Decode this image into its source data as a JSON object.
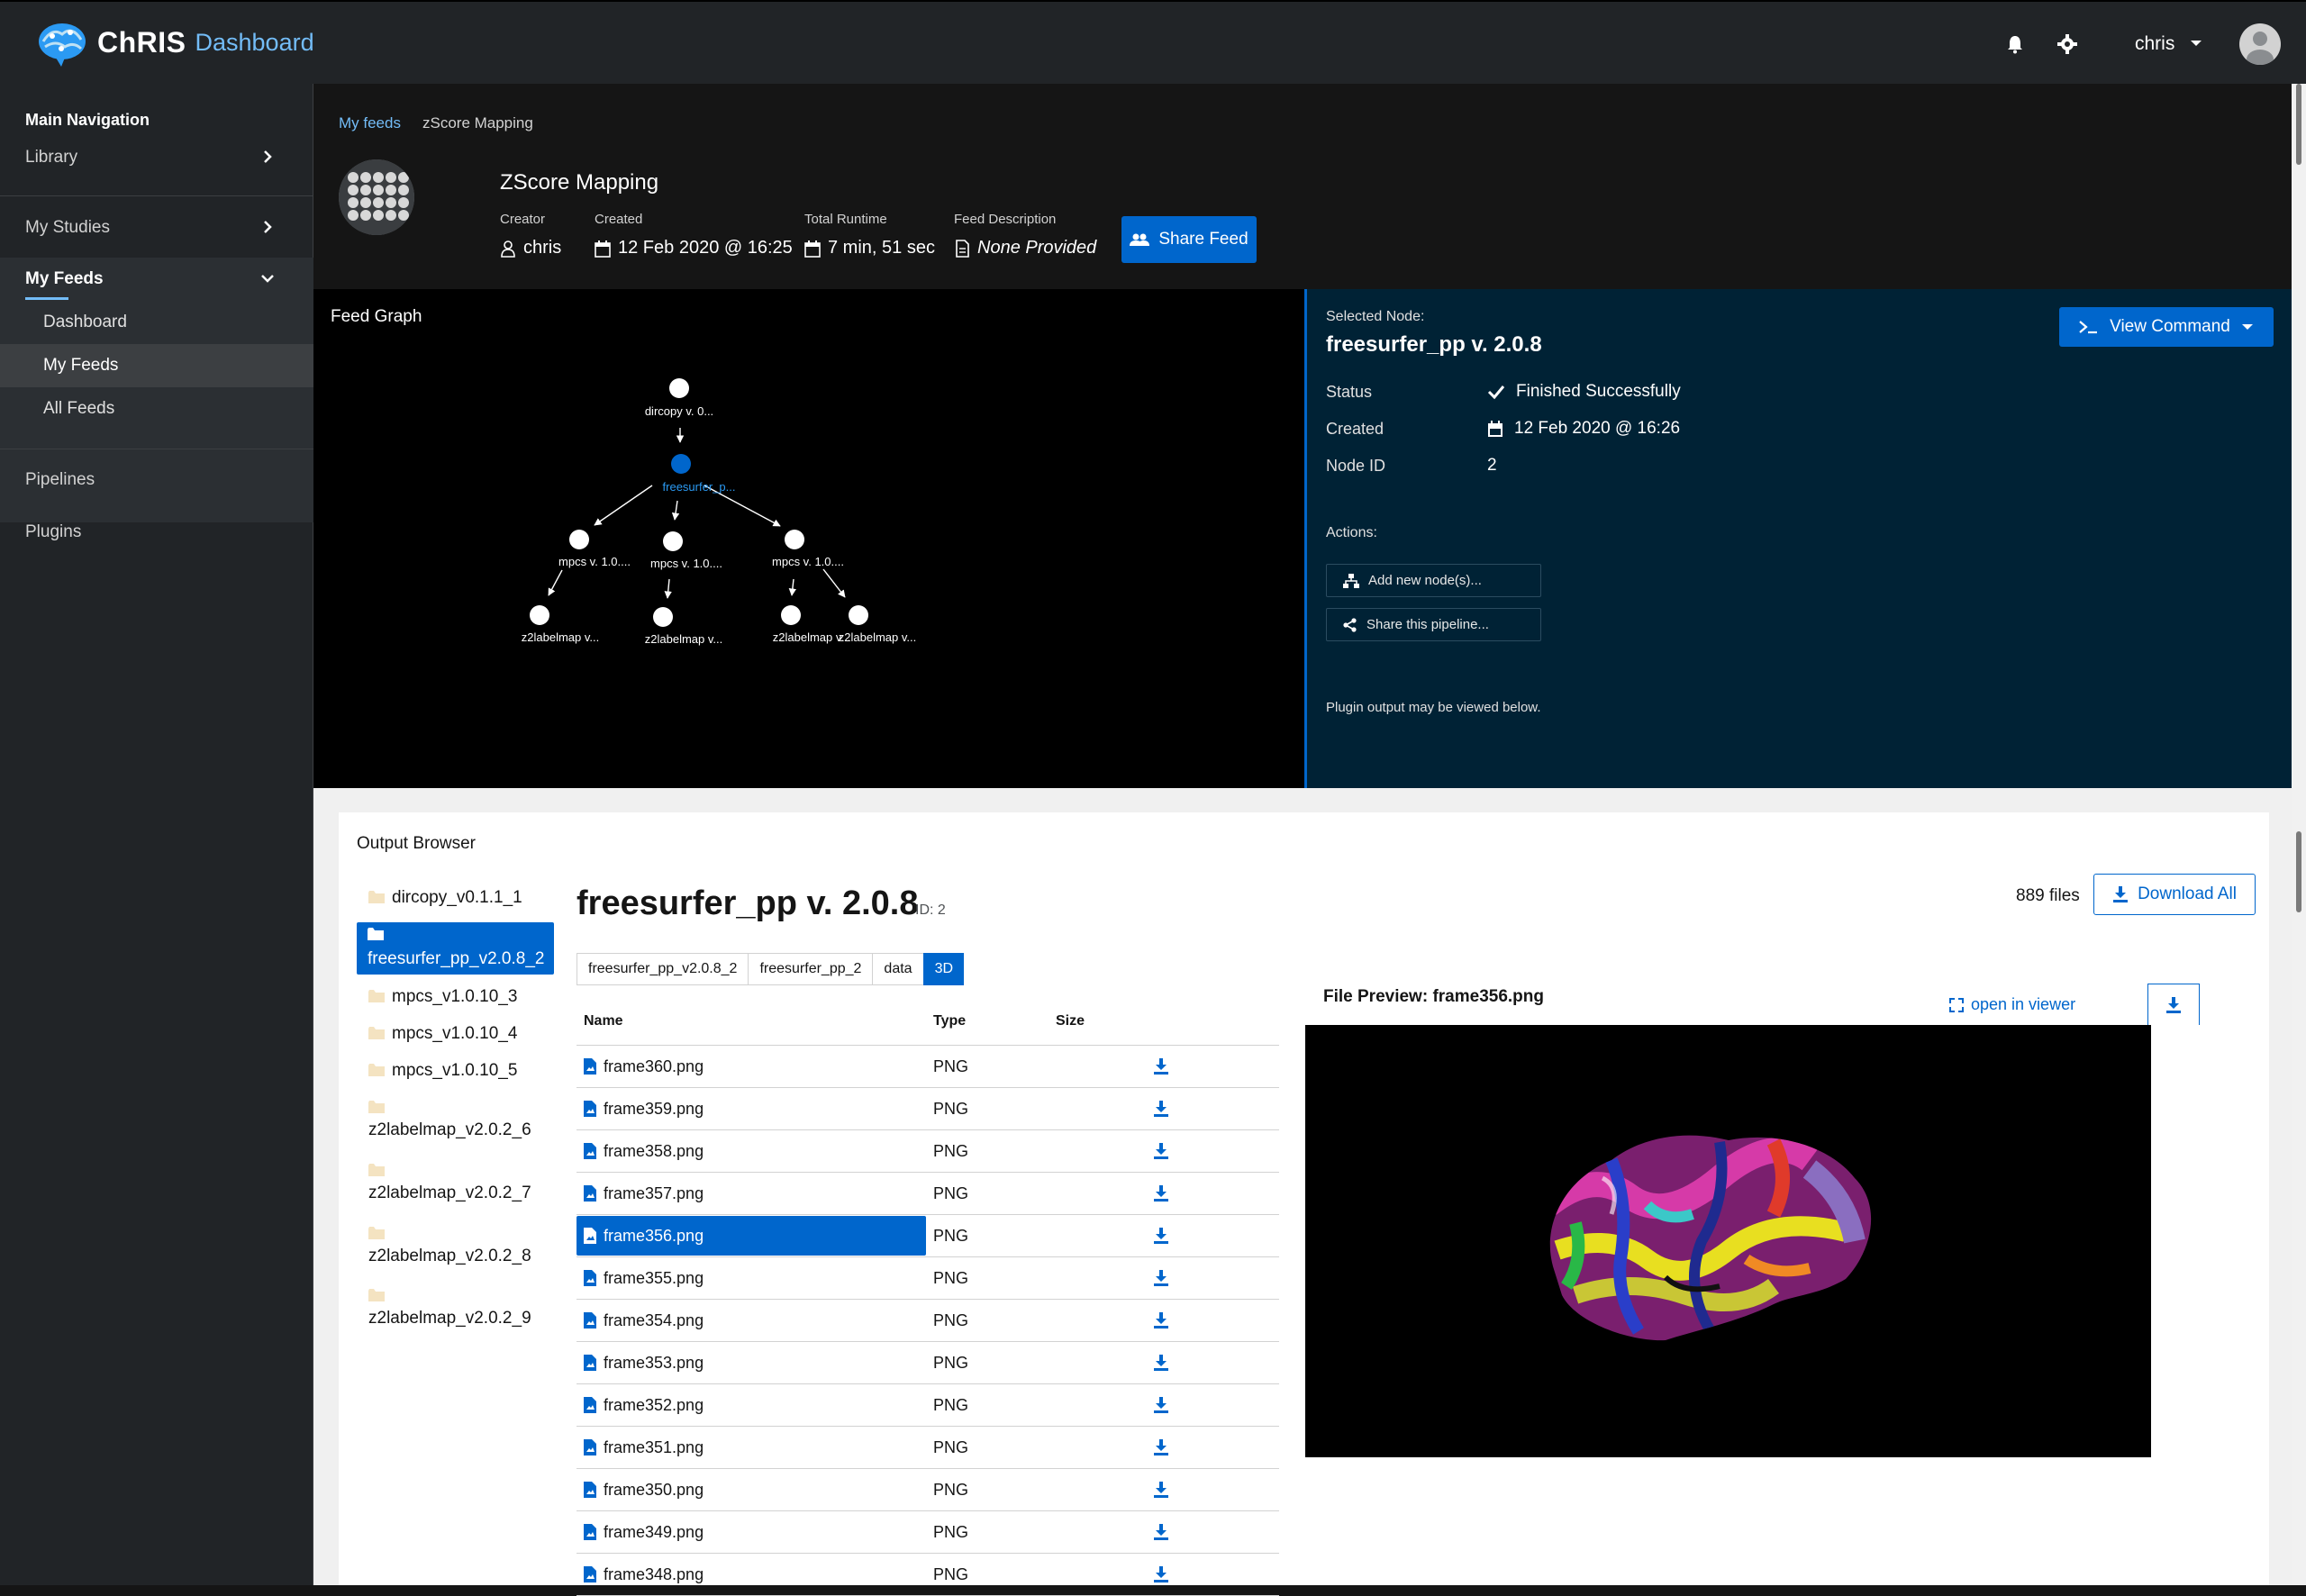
{
  "masthead": {
    "brand_name": "ChRIS",
    "brand_sub": "Dashboard",
    "user": "chris"
  },
  "sidebar": {
    "title": "Main Navigation",
    "items": [
      {
        "label": "Library"
      },
      {
        "label": "My Studies"
      },
      {
        "label": "My Feeds"
      },
      {
        "label": "Pipelines"
      },
      {
        "label": "Plugins"
      }
    ],
    "subitems": [
      {
        "label": "Dashboard"
      },
      {
        "label": "My Feeds"
      },
      {
        "label": "All Feeds"
      }
    ]
  },
  "feed": {
    "breadcrumb": [
      "My feeds",
      "zScore Mapping"
    ],
    "title": "ZScore Mapping",
    "creator_label": "Creator",
    "creator": "chris",
    "created_label": "Created",
    "created": "12 Feb 2020 @ 16:25",
    "runtime_label": "Total Runtime",
    "runtime": "7 min, 51 sec",
    "desc_label": "Feed Description",
    "desc": "None Provided",
    "share_label": "Share Feed"
  },
  "graph": {
    "title": "Feed Graph",
    "nodes": [
      {
        "label": "dircopy v. 0..."
      },
      {
        "label": "freesurfer_p..."
      },
      {
        "label": "mpcs v. 1.0...."
      },
      {
        "label": "mpcs v. 1.0...."
      },
      {
        "label": "mpcs v. 1.0...."
      },
      {
        "label": "z2labelmap v..."
      },
      {
        "label": "z2labelmap v..."
      },
      {
        "label": "z2labelmap v..."
      },
      {
        "label": "z2labelmap v..."
      }
    ]
  },
  "node": {
    "selected_label": "Selected Node:",
    "title": "freesurfer_pp v. 2.0.8",
    "view_command": "View Command",
    "status_key": "Status",
    "status": "Finished Successfully",
    "created_key": "Created",
    "created": "12 Feb 2020 @ 16:26",
    "id_key": "Node ID",
    "id": "2",
    "actions_label": "Actions:",
    "add_node": "Add new node(s)...",
    "share_pipeline": "Share this pipeline...",
    "output_note": "Plugin output may be viewed below."
  },
  "output": {
    "title": "Output Browser",
    "dirs": [
      "dircopy_v0.1.1_1",
      "freesurfer_pp_v2.0.8_2",
      "mpcs_v1.0.10_3",
      "mpcs_v1.0.10_4",
      "mpcs_v1.0.10_5",
      "z2labelmap_v2.0.2_6",
      "z2labelmap_v2.0.2_7",
      "z2labelmap_v2.0.2_8",
      "z2labelmap_v2.0.2_9"
    ],
    "plugin_title": "freesurfer_pp v. 2.0.8",
    "plugin_id": "ID: 2",
    "files_count": "889 files",
    "download_all": "Download All",
    "path": [
      "freesurfer_pp_v2.0.8_2",
      "freesurfer_pp_2",
      "data",
      "3D"
    ],
    "columns": {
      "name": "Name",
      "type": "Type",
      "size": "Size"
    },
    "files": [
      {
        "name": "frame360.png",
        "type": "PNG"
      },
      {
        "name": "frame359.png",
        "type": "PNG"
      },
      {
        "name": "frame358.png",
        "type": "PNG"
      },
      {
        "name": "frame357.png",
        "type": "PNG"
      },
      {
        "name": "frame356.png",
        "type": "PNG"
      },
      {
        "name": "frame355.png",
        "type": "PNG"
      },
      {
        "name": "frame354.png",
        "type": "PNG"
      },
      {
        "name": "frame353.png",
        "type": "PNG"
      },
      {
        "name": "frame352.png",
        "type": "PNG"
      },
      {
        "name": "frame351.png",
        "type": "PNG"
      },
      {
        "name": "frame350.png",
        "type": "PNG"
      },
      {
        "name": "frame349.png",
        "type": "PNG"
      },
      {
        "name": "frame348.png",
        "type": "PNG"
      }
    ],
    "preview_title": "File Preview: frame356.png",
    "open_viewer": "open in viewer"
  },
  "colors": {
    "accent": "#0066cc",
    "link": "#73bcf7",
    "node_panel": "#002235"
  }
}
